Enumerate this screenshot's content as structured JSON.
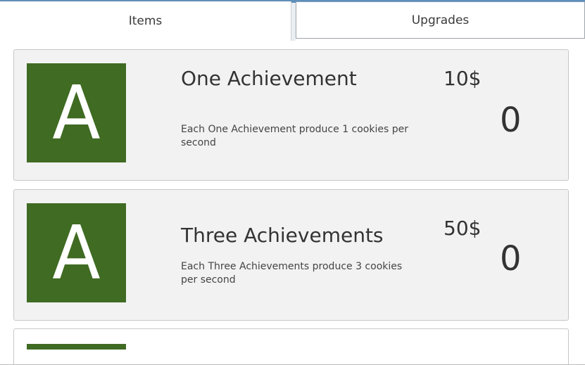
{
  "tabs": {
    "items_label": "Items",
    "upgrades_label": "Upgrades"
  },
  "items": [
    {
      "thumb_letter": "A",
      "title": "One Achievement",
      "description": "Each One Achievement  produce 1 cookies per second",
      "price": "10$",
      "count": "0"
    },
    {
      "thumb_letter": "A",
      "title": "Three Achievements",
      "description": "Each Three Achievements produce 3 cookies per second",
      "price": "50$",
      "count": "0"
    }
  ],
  "colors": {
    "thumb_bg": "#3f6b22",
    "card_bg": "#f2f2f2",
    "text": "#333333"
  }
}
